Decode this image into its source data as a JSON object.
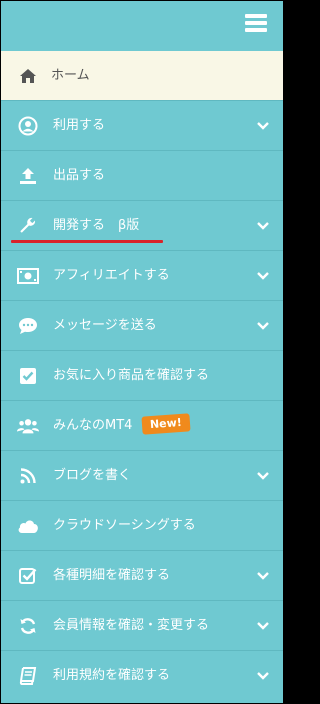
{
  "header": {
    "menu_icon": "hamburger-icon"
  },
  "menu": {
    "home": "ホーム",
    "use": "利用する",
    "list_item": "出品する",
    "develop": "開発する　β版",
    "affiliate": "アフィリエイトする",
    "message": "メッセージを送る",
    "favorites": "お気に入り商品を確認する",
    "mt4": "みんなのMT4",
    "mt4_badge": "New!",
    "blog": "ブログを書く",
    "crowdsourcing": "クラウドソーシングする",
    "statements": "各種明細を確認する",
    "member_info": "会員情報を確認・変更する",
    "terms": "利用規約を確認する"
  },
  "colors": {
    "sidebar_bg": "#6fc9d1",
    "home_bg": "#f9f7e6",
    "badge": "#f08a1c",
    "highlight_underline": "#d8232a"
  }
}
